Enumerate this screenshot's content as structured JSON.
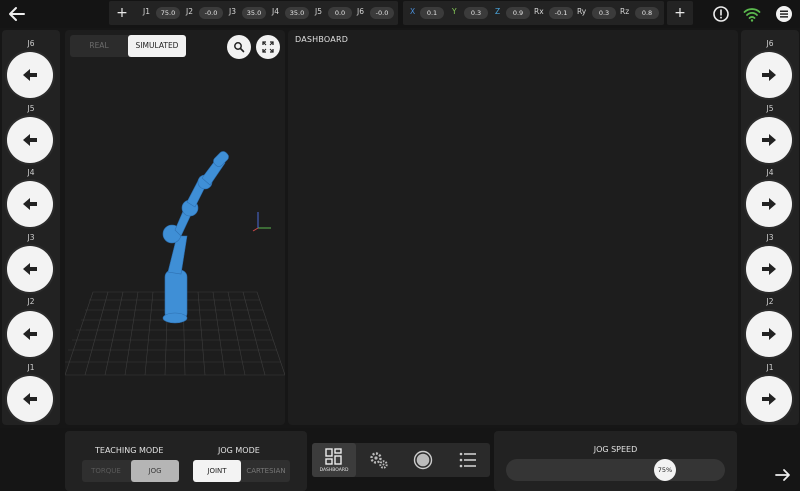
{
  "colors": {
    "background": "#161616",
    "panel": "#222222",
    "robot": "#3f8fd6",
    "accent_x": "#4a8ed8",
    "accent_y": "#89cf5a",
    "wifi": "#5bb94e"
  },
  "topbar": {
    "back_icon": "arrow-left-icon",
    "add_label": "+",
    "joints": [
      {
        "label": "J1",
        "value": "75.0"
      },
      {
        "label": "J2",
        "value": "-0.0"
      },
      {
        "label": "J3",
        "value": "35.0"
      },
      {
        "label": "J4",
        "value": "35.0"
      },
      {
        "label": "J5",
        "value": "0.0"
      },
      {
        "label": "J6",
        "value": "-0.0"
      }
    ],
    "cartesian": [
      {
        "label": "X",
        "value": "0.1"
      },
      {
        "label": "Y",
        "value": "0.3"
      },
      {
        "label": "Z",
        "value": "0.9"
      },
      {
        "label": "Rx",
        "value": "-0.1"
      },
      {
        "label": "Ry",
        "value": "0.3"
      },
      {
        "label": "Rz",
        "value": "0.8"
      }
    ],
    "add_label_2": "+",
    "icons": [
      "alert-icon",
      "wifi-icon",
      "menu-icon"
    ]
  },
  "left_jogs": [
    {
      "label": "J6",
      "icon": "arrow-left-icon"
    },
    {
      "label": "J5",
      "icon": "arrow-left-icon"
    },
    {
      "label": "J4",
      "icon": "arrow-left-icon"
    },
    {
      "label": "J3",
      "icon": "arrow-left-icon"
    },
    {
      "label": "J2",
      "icon": "arrow-left-icon"
    },
    {
      "label": "J1",
      "icon": "arrow-left-icon"
    }
  ],
  "right_jogs": [
    {
      "label": "J6",
      "icon": "arrow-right-icon"
    },
    {
      "label": "J5",
      "icon": "arrow-right-icon"
    },
    {
      "label": "J4",
      "icon": "arrow-right-icon"
    },
    {
      "label": "J3",
      "icon": "arrow-right-icon"
    },
    {
      "label": "J2",
      "icon": "arrow-right-icon"
    },
    {
      "label": "J1",
      "icon": "arrow-right-icon"
    }
  ],
  "viewport": {
    "real_label": "REAL",
    "simulated_label": "SIMULATED",
    "selected": "SIMULATED"
  },
  "dashboard": {
    "title": "DASHBOARD"
  },
  "teaching": {
    "title": "TEACHING MODE",
    "options": [
      "TORQUE",
      "JOG"
    ],
    "selected": "JOG"
  },
  "jog_mode": {
    "title": "JOG MODE",
    "options": [
      "JOINT",
      "CARTESIAN"
    ],
    "selected": "JOINT"
  },
  "navbar": {
    "items": [
      {
        "icon": "dashboard-icon",
        "label": "DASHBOARD",
        "active": true
      },
      {
        "icon": "gears-icon",
        "label": ""
      },
      {
        "icon": "record-icon",
        "label": ""
      },
      {
        "icon": "list-icon",
        "label": ""
      }
    ]
  },
  "jog_speed": {
    "title": "JOG SPEED",
    "value": "75%",
    "fraction": 0.75
  },
  "next_icon": "arrow-right-icon"
}
